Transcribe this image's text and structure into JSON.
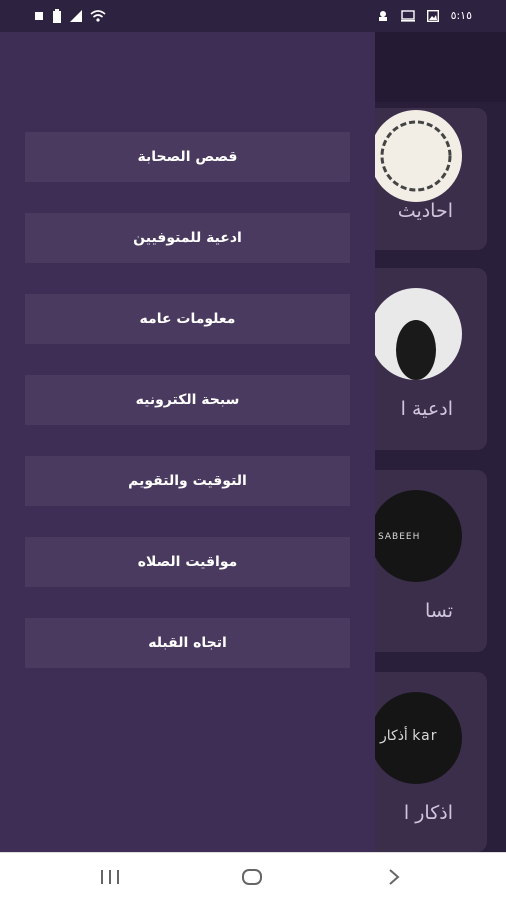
{
  "status_bar": {
    "time": "٥:١٥",
    "left_icons": [
      "sim-icon",
      "battery-icon",
      "signal-icon",
      "wifi-icon"
    ],
    "right_icons": [
      "vpn-icon",
      "cast-icon",
      "gallery-icon"
    ]
  },
  "drawer": {
    "items": [
      {
        "label": "قصص الصحابة"
      },
      {
        "label": "ادعية للمتوفيين"
      },
      {
        "label": "معلومات عامه"
      },
      {
        "label": "سبحة الكترونيه"
      },
      {
        "label": "التوقيت والتقويم"
      },
      {
        "label": "مواقيت الصلاه"
      },
      {
        "label": "اتجاه القبله"
      }
    ]
  },
  "background_cards": [
    {
      "title": "احاديث",
      "circle_text": ""
    },
    {
      "title": "ادعية ا",
      "circle_text": ""
    },
    {
      "title": "تسا",
      "circle_text": "SABEEH"
    },
    {
      "title": "اذكار ا",
      "circle_text": "أذكار kar"
    }
  ],
  "nav_bar": {
    "buttons": [
      "recents-icon",
      "home-icon",
      "back-icon"
    ]
  },
  "colors": {
    "drawer_bg": "#3e2d54",
    "menu_item_bg": "#4a3a60",
    "app_bg": "#2a1f3a",
    "card_bg": "#3a2e4b"
  }
}
